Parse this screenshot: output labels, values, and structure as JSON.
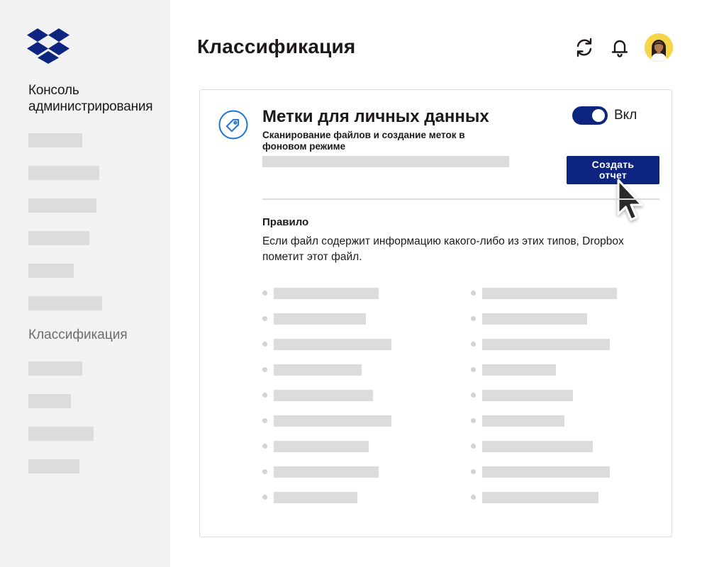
{
  "sidebar": {
    "title": "Консоль администрирования",
    "active_item": "Классификация"
  },
  "header": {
    "title": "Классификация",
    "icons": [
      "sync-icon",
      "bell-icon",
      "avatar"
    ]
  },
  "card": {
    "icon": "tag-icon",
    "title": "Метки для личных данных",
    "subtitle": "Сканирование файлов и создание меток в фоновом режиме",
    "toggle_label": "Вкл",
    "toggle_on": true,
    "report_button": "Создать отчет",
    "rule_heading": "Правило",
    "rule_text": "Если файл содержит информацию какого-либо из этих типов, Dropbox пометит этот файл."
  },
  "colors": {
    "accent": "#0d2481",
    "sidebar_bg": "#f2f2f2",
    "placeholder": "#dcdcdc",
    "tag_icon": "#1f72d6",
    "avatar_bg": "#f5d54a"
  }
}
